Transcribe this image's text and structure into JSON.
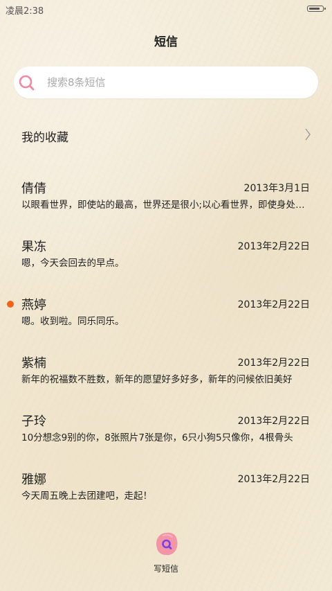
{
  "status_bar": {
    "time": "凌晨2:38",
    "battery_level": 0.9
  },
  "header": {
    "title": "短信"
  },
  "search": {
    "placeholder": "搜索8条短信",
    "value": ""
  },
  "favorites": {
    "label": "我的收藏"
  },
  "messages": [
    {
      "name": "倩倩",
      "date": "2013年3月1日",
      "preview": "以眼看世界，即使站的最高，世界还是很小;以心看世界，即使身处陋室，世界也很大",
      "unread": false
    },
    {
      "name": "果冻",
      "date": "2013年2月22日",
      "preview": "嗯，今天会回去的早点。",
      "unread": false
    },
    {
      "name": "燕婷",
      "date": "2013年2月22日",
      "preview": "嗯。收到啦。同乐同乐。",
      "unread": true
    },
    {
      "name": "紫楠",
      "date": "2013年2月22日",
      "preview": "新年的祝福数不胜数，新年的愿望好多好多，新年的问候依旧美好",
      "unread": false
    },
    {
      "name": "子玲",
      "date": "2013年2月22日",
      "preview": "10分想念9别的你，8张照片7张是你，6只小狗5只像你，4根骨头",
      "unread": false
    },
    {
      "name": "雅娜",
      "date": "2013年2月22日",
      "preview": "今天周五晚上去团建吧，走起！",
      "unread": false
    }
  ],
  "compose": {
    "label": "写短信"
  },
  "colors": {
    "accent_pink": "#f28ca3",
    "search_icon_pink": "#f08aa4",
    "unread_dot": "#f0631c",
    "compose_q": "#7b3fe4"
  }
}
